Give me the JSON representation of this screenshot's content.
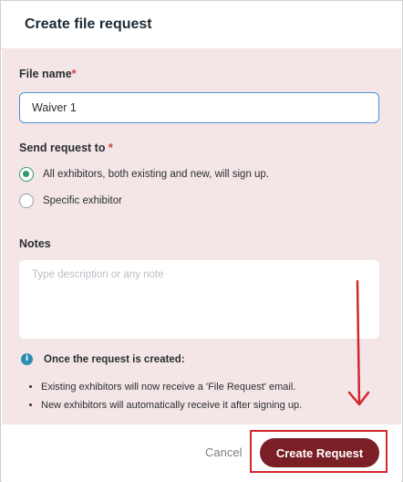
{
  "dialog": {
    "title": "Create file request"
  },
  "file_name": {
    "label": "File name",
    "required_mark": "*",
    "value": "Waiver 1"
  },
  "send_to": {
    "label": "Send request to",
    "required_mark": "*",
    "options": [
      {
        "label": "All exhibitors, both existing and new, will sign up.",
        "selected": true
      },
      {
        "label": "Specific exhibitor",
        "selected": false
      }
    ]
  },
  "notes": {
    "label": "Notes",
    "placeholder": "Type description or any note"
  },
  "info": {
    "icon": "info-icon",
    "heading": "Once the request is created:",
    "bullets": [
      "Existing exhibitors will now receive a 'File Request' email.",
      "New exhibitors will automatically receive it after signing up."
    ]
  },
  "footer": {
    "cancel_label": "Cancel",
    "submit_label": "Create Request"
  },
  "annotation": {
    "highlight_color": "#d3262d",
    "arrow_color": "#d3262d"
  },
  "colors": {
    "accent": "#7a1f26",
    "body_bg": "#f4e6e6",
    "radio_selected": "#2e9b6b",
    "input_focus": "#4a8fd6"
  }
}
